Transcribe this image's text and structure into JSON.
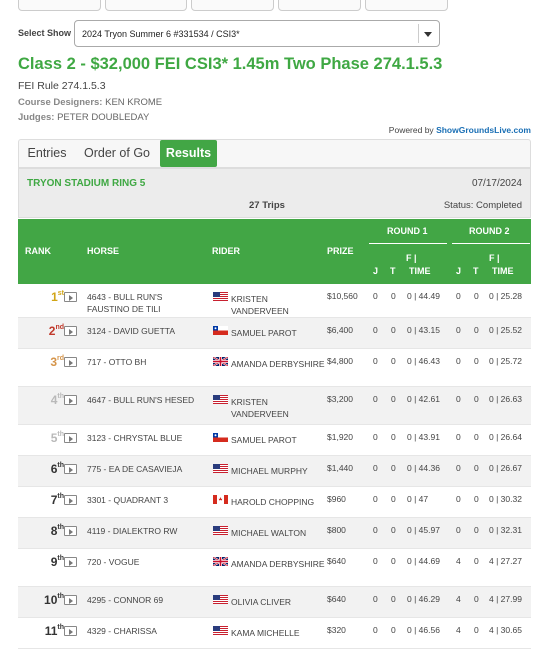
{
  "select": {
    "label": "Select Show",
    "value": "2024 Tryon Summer 6 #331534 / CSI3*"
  },
  "event": {
    "title": "Class 2 - $32,000 FEI CSI3* 1.45m Two Phase 274.1.5.3",
    "rule": "FEI Rule 274.1.5.3",
    "designers_label": "Course Designers:",
    "designers": "KEN KROME",
    "judges_label": "Judges:",
    "judges": "PETER DOUBLEDAY"
  },
  "powered": {
    "prefix": "Powered by",
    "link": "ShowGroundsLive.com"
  },
  "tabs": [
    {
      "label": "Entries"
    },
    {
      "label": "Order of Go"
    },
    {
      "label": "Results"
    }
  ],
  "ring": {
    "name": "TRYON STADIUM RING 5",
    "date": "07/17/2024",
    "trips": "27 Trips",
    "status": "Status: Completed"
  },
  "columns": {
    "rank": "RANK",
    "horse": "HORSE",
    "rider": "RIDER",
    "prize": "PRIZE",
    "round1": "ROUND 1",
    "round2": "ROUND 2",
    "j": "J",
    "t": "T",
    "f": "F |",
    "time": "TIME"
  },
  "colors": {
    "accent": "#42a645",
    "title": "#3fa843",
    "medal_gold": "#d1a516",
    "medal_silver": "#b9b9b9",
    "medal_bronze": "#d59449"
  },
  "results": [
    {
      "rank": "1",
      "suf": "st",
      "horse": "4643 - BULL RUN'S FAUSTINO DE TILI",
      "flag": "us",
      "rider": "Kristen Vanderveen",
      "prize": "$10,560",
      "j1": "0",
      "t1": "0",
      "ft1": "0 | 44.49",
      "j2": "0",
      "t2": "0",
      "ft2": "0 | 25.28"
    },
    {
      "rank": "2",
      "suf": "nd",
      "horse": "3124 - DAVID GUETTA",
      "flag": "cl",
      "rider": "Samuel Parot",
      "prize": "$6,400",
      "j1": "0",
      "t1": "0",
      "ft1": "0 | 43.15",
      "j2": "0",
      "t2": "0",
      "ft2": "0 | 25.52"
    },
    {
      "rank": "3",
      "suf": "rd",
      "horse": "717 - OTTO BH",
      "flag": "gb",
      "rider": "Amanda Derbyshire",
      "prize": "$4,800",
      "j1": "0",
      "t1": "0",
      "ft1": "0 | 46.43",
      "j2": "0",
      "t2": "0",
      "ft2": "0 | 25.72"
    },
    {
      "rank": "4",
      "suf": "th",
      "horse": "4647 - BULL RUN'S HESED",
      "flag": "us",
      "rider": "Kristen Vanderveen",
      "prize": "$3,200",
      "j1": "0",
      "t1": "0",
      "ft1": "0 | 42.61",
      "j2": "0",
      "t2": "0",
      "ft2": "0 | 26.63"
    },
    {
      "rank": "5",
      "suf": "th",
      "horse": "3123 - CHRYSTAL BLUE",
      "flag": "cl",
      "rider": "Samuel Parot",
      "prize": "$1,920",
      "j1": "0",
      "t1": "0",
      "ft1": "0 | 43.91",
      "j2": "0",
      "t2": "0",
      "ft2": "0 | 26.64"
    },
    {
      "rank": "6",
      "suf": "th",
      "horse": "775 - EA DE CASAVIEJA",
      "flag": "us",
      "rider": "Michael Murphy",
      "prize": "$1,440",
      "j1": "0",
      "t1": "0",
      "ft1": "0 | 44.36",
      "j2": "0",
      "t2": "0",
      "ft2": "0 | 26.67"
    },
    {
      "rank": "7",
      "suf": "th",
      "horse": "3301 - QUADRANT 3",
      "flag": "ca",
      "rider": "Harold Chopping",
      "prize": "$960",
      "j1": "0",
      "t1": "0",
      "ft1": "0 | 47",
      "j2": "0",
      "t2": "0",
      "ft2": "0 | 30.32"
    },
    {
      "rank": "8",
      "suf": "th",
      "horse": "4119 - DIALEKTRO RW",
      "flag": "us",
      "rider": "Michael Walton",
      "prize": "$800",
      "j1": "0",
      "t1": "0",
      "ft1": "0 | 45.97",
      "j2": "0",
      "t2": "0",
      "ft2": "0 | 32.31"
    },
    {
      "rank": "9",
      "suf": "th",
      "horse": "720 - VOGUE",
      "flag": "gb",
      "rider": "Amanda Derbyshire",
      "prize": "$640",
      "j1": "0",
      "t1": "0",
      "ft1": "0 | 44.69",
      "j2": "4",
      "t2": "0",
      "ft2": "4 | 27.27"
    },
    {
      "rank": "10",
      "suf": "th",
      "horse": "4295 - CONNOR 69",
      "flag": "us",
      "rider": "Olivia Cliver",
      "prize": "$640",
      "j1": "0",
      "t1": "0",
      "ft1": "0 | 46.29",
      "j2": "4",
      "t2": "0",
      "ft2": "4 | 27.99"
    },
    {
      "rank": "11",
      "suf": "th",
      "horse": "4329 - CHARISSA",
      "flag": "us",
      "rider": "Kama Michelle",
      "prize": "$320",
      "j1": "0",
      "t1": "0",
      "ft1": "0 | 46.56",
      "j2": "4",
      "t2": "0",
      "ft2": "4 | 30.65"
    }
  ]
}
